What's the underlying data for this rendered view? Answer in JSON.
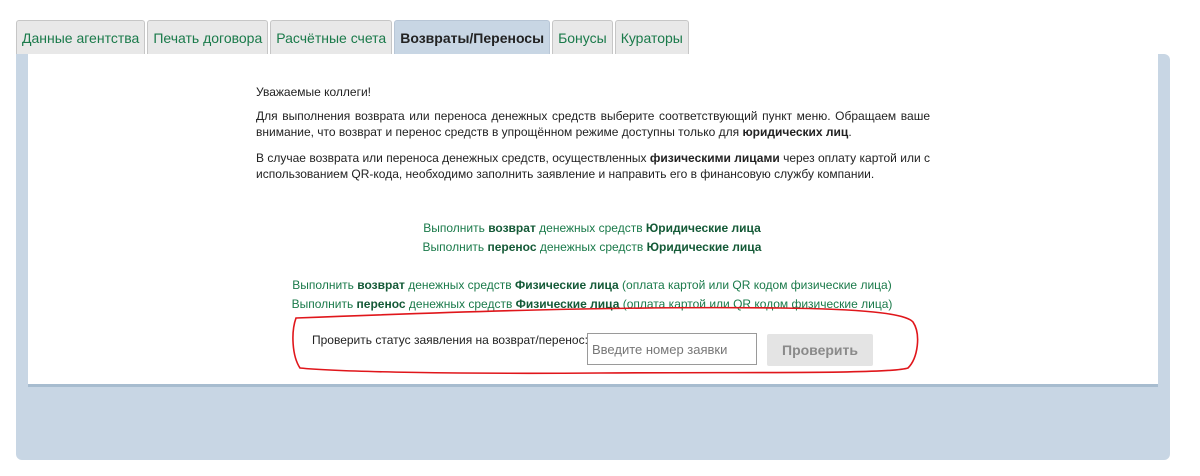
{
  "tabs": [
    {
      "label": "Данные агентства",
      "active": false
    },
    {
      "label": "Печать договора",
      "active": false
    },
    {
      "label": "Расчётные счета",
      "active": false
    },
    {
      "label": "Возвраты/Переносы",
      "active": true
    },
    {
      "label": "Бонусы",
      "active": false
    },
    {
      "label": "Кураторы",
      "active": false
    }
  ],
  "intro": {
    "greeting": "Уважаемые коллеги!",
    "p1_text": "Для выполнения возврата или переноса денежных средств выберите соответствующий пункт меню. Обращаем ваше внимание, что возврат и перенос средств в упрощённом режиме доступны только для ",
    "p1_bold": "юридических лиц",
    "p1_end": ".",
    "p2_text": "В случае возврата или переноса денежных средств, осуществленных ",
    "p2_bold": "физическими лицами",
    "p2_end": " через оплату картой или с использованием QR-кода, необходимо заполнить заявление и направить его в финансовую службу компании."
  },
  "links": {
    "legal_return": {
      "pre": "Выполнить ",
      "action": "возврат",
      "mid": " денежных средств ",
      "who": "Юридические лица"
    },
    "legal_transfer": {
      "pre": "Выполнить ",
      "action": "перенос",
      "mid": " денежных средств ",
      "who": "Юридические лица"
    },
    "phys_return": {
      "pre": "Выполнить ",
      "action": "возврат",
      "mid": " денежных средств ",
      "who": "Физические лица",
      "post": " (оплата картой или QR кодом физические лица)"
    },
    "phys_transfer": {
      "pre": "Выполнить ",
      "action": "перенос",
      "mid": " денежных средств ",
      "who": "Физические лица",
      "post": " (оплата картой или QR кодом физические лица)"
    }
  },
  "check": {
    "label": "Проверить статус заявления на возврат/перенос:",
    "placeholder": "Введите номер заявки",
    "value": "",
    "button": "Проверить"
  },
  "colors": {
    "link": "#1a7a4a",
    "panel": "#c8d6e4",
    "highlight": "#e0161b"
  }
}
